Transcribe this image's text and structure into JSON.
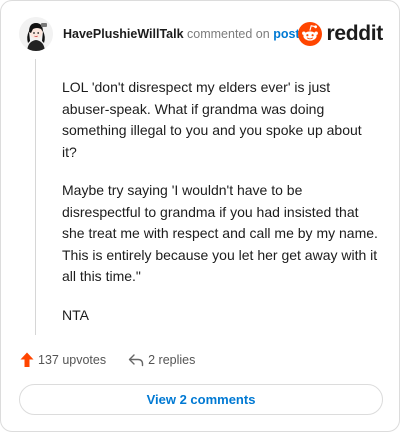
{
  "comment": {
    "author": "HavePlushieWillTalk",
    "action_text": "commented on",
    "post_link": "post",
    "paragraphs": [
      "LOL 'don't disrespect my elders ever' is just abuser-speak. What if grandma was doing something illegal to you and you spoke up about it?",
      "Maybe try saying 'I wouldn't have to be disrespectful to grandma if you had insisted that she treat me with respect and call me by my name. This is entirely because you let her get away with it all this time.\"",
      "NTA"
    ]
  },
  "brand": {
    "wordmark": "reddit",
    "icon": "reddit-snoo-icon",
    "color": "#ff4500"
  },
  "actions": {
    "upvotes": "137 upvotes",
    "replies": "2 replies"
  },
  "footer": {
    "view_comments": "View 2 comments"
  },
  "colors": {
    "upvote": "#ff4500",
    "link": "#0079d3",
    "text": "#1c1c1c",
    "muted": "#7c7c7c",
    "border": "#dcdcdc"
  }
}
